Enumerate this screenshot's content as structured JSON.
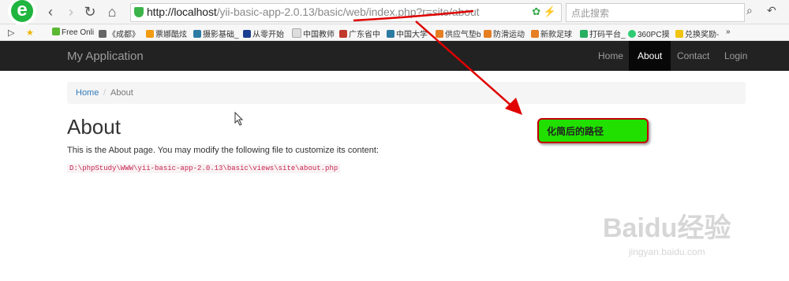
{
  "browser": {
    "nav_back": "‹",
    "nav_forward": "›",
    "nav_refresh": "↻",
    "nav_home": "⌂",
    "url_host": "http://localhost",
    "url_path": "/yii-basic-app-2.0.13/basic/web/index.php?r=site/about",
    "search_placeholder": "点此搜索",
    "bookmarks": [
      "Free Onli",
      "《成都》",
      "票娜酷炫",
      "摄影基础_",
      "从零开始",
      "中国教师",
      "广东省中",
      "中国大学",
      "供应气垫b",
      "防滑运动",
      "新款足球",
      "打码平台_",
      "360PC摸",
      "兑换奖励-"
    ],
    "more": "»"
  },
  "page": {
    "brand": "My Application",
    "nav": [
      "Home",
      "About",
      "Contact",
      "Login"
    ],
    "active_nav": "About",
    "breadcrumb_home": "Home",
    "breadcrumb_sep": "/",
    "breadcrumb_current": "About",
    "title": "About",
    "description": "This is the About page. You may modify the following file to customize its content:",
    "file_path": "D:\\phpStudy\\WWW\\yii-basic-app-2.0.13\\basic\\views\\site\\about.php"
  },
  "annotation": {
    "callout_text": "化简后的路径",
    "arrow_color": "#e00000",
    "callout_color": "#21e000"
  },
  "watermark": {
    "main": "Baidu经验",
    "sub": "jingyan.baidu.com"
  }
}
